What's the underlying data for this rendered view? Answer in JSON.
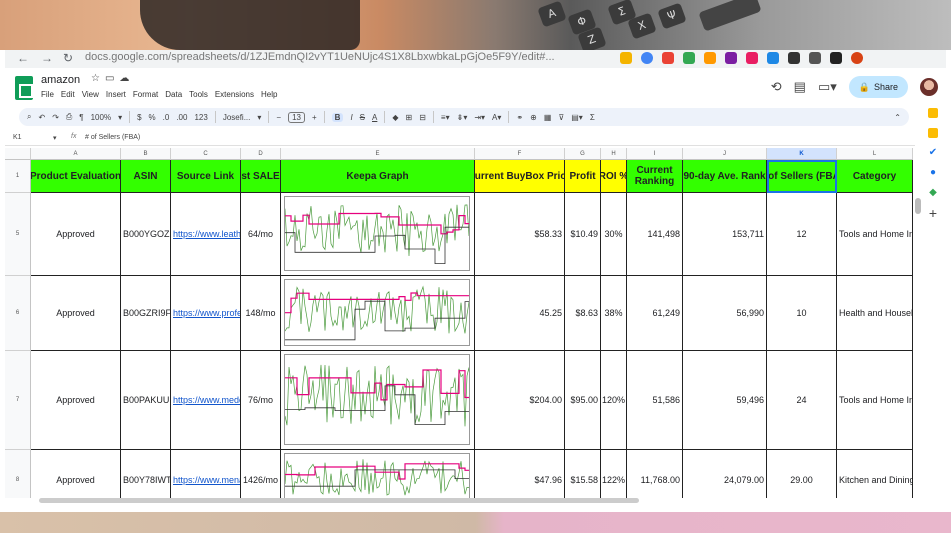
{
  "browser": {
    "url": "docs.google.com/spreadsheets/d/1ZJEmdnQI2vYT1UeNUjc4S1X8LbxwbkaLpGjOe5F9Y/edit#..."
  },
  "doc": {
    "title": "amazon",
    "menus": [
      "File",
      "Edit",
      "View",
      "Insert",
      "Format",
      "Data",
      "Tools",
      "Extensions",
      "Help"
    ],
    "share_label": "Share"
  },
  "toolbar": {
    "zoom": "100%",
    "currency": "$",
    "percent": "%",
    "dec_decrease": ".0",
    "dec_increase": ".00",
    "number_format": "123",
    "font": "Josefi...",
    "font_size": "13",
    "bold": "B",
    "italic": "I",
    "strike": "S",
    "underline": "A"
  },
  "formula": {
    "cell_ref": "K1",
    "fx": "fx",
    "content": "# of Sellers (FBA)"
  },
  "columns": [
    "A",
    "B",
    "C",
    "D",
    "E",
    "F",
    "G",
    "H",
    "I",
    "J",
    "K",
    "L"
  ],
  "headers": [
    "Product Evaluation",
    "ASIN",
    "Source Link",
    "Est SALES",
    "Keepa Graph",
    "Current BuyBox Price",
    "Profit",
    "ROI %",
    "Current Ranking",
    "90-day Ave. Rank",
    "# of Sellers (FBA)",
    "Category"
  ],
  "header_row_num": "1",
  "rows": [
    {
      "num": "5",
      "eval": "Approved",
      "asin": "B000YGOZLQ",
      "link": "https://www.leatherman...",
      "sales": "64/mo",
      "buybox": "$58.33",
      "profit": "$10.49",
      "roi": "30%",
      "rank": "141,498",
      "avg_rank": "153,711",
      "sellers": "12",
      "category": "Tools and Home Improvement"
    },
    {
      "num": "6",
      "eval": "Approved",
      "asin": "B00GZRI9FA",
      "link": "https://www.profe...",
      "sales": "148/mo",
      "buybox": "45.25",
      "profit": "$8.63",
      "roi": "38%",
      "rank": "61,249",
      "avg_rank": "56,990",
      "sellers": "10",
      "category": "Health and Household"
    },
    {
      "num": "7",
      "eval": "Approved",
      "asin": "B00PAKUUIQ",
      "link": "https://www.medos.sh...",
      "sales": "76/mo",
      "buybox": "$204.00",
      "profit": "$95.00",
      "roi": "120%",
      "rank": "51,586",
      "avg_rank": "59,496",
      "sellers": "24",
      "category": "Tools and Home Improvement"
    },
    {
      "num": "8",
      "eval": "Approved",
      "asin": "B00Y78IWTG",
      "link": "https://www.menards.c...",
      "sales": "1426/mo",
      "buybox": "$47.96",
      "profit": "$15.58",
      "roi": "122%",
      "rank": "11,768.00",
      "avg_rank": "24,079.00",
      "sellers": "29.00",
      "category": "Kitchen and Dining"
    }
  ],
  "colors": {
    "green": "#33ff00",
    "yellow": "#ffff00",
    "keepa_pink": "#e6007e",
    "keepa_green": "#4a9a3c"
  }
}
